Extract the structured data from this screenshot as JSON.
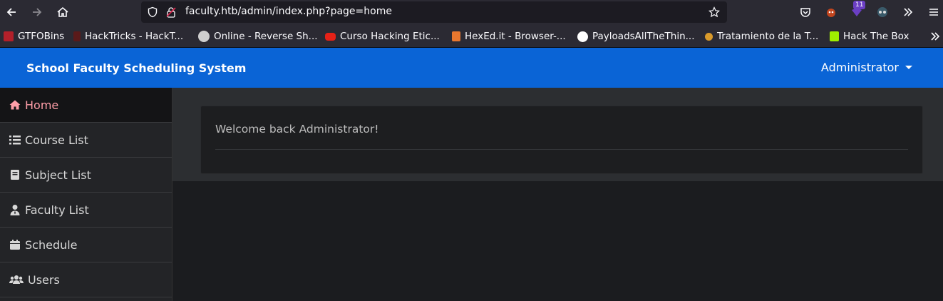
{
  "browser": {
    "url": "faculty.htb/admin/index.php?page=home",
    "extension_badge": "11",
    "bookmarks": [
      {
        "label": "GTFOBins",
        "color": "#b3202a"
      },
      {
        "label": "HackTricks - HackT...",
        "color": "#5a1a1a"
      },
      {
        "label": "Online - Reverse Sh...",
        "color": "#cfcfcf"
      },
      {
        "label": "Curso Hacking Etic...",
        "color": "#e62117"
      },
      {
        "label": "HexEd.it - Browser-...",
        "color": "#e8772e"
      },
      {
        "label": "PayloadsAllTheThin...",
        "color": "#ffffff"
      },
      {
        "label": "Tratamiento de la T...",
        "color": "#d99a2b"
      },
      {
        "label": "Hack The Box",
        "color": "#9fef00"
      }
    ]
  },
  "app": {
    "brand": "School Faculty Scheduling System",
    "user": "Administrator",
    "header_color": "#0a64d6",
    "sidebar": [
      {
        "label": "Home",
        "icon": "home-icon"
      },
      {
        "label": "Course List",
        "icon": "list-icon"
      },
      {
        "label": "Subject List",
        "icon": "book-icon"
      },
      {
        "label": "Faculty List",
        "icon": "user-tie-icon"
      },
      {
        "label": "Schedule",
        "icon": "calendar-icon"
      },
      {
        "label": "Users",
        "icon": "users-icon"
      }
    ],
    "welcome": "Welcome back Administrator!"
  }
}
